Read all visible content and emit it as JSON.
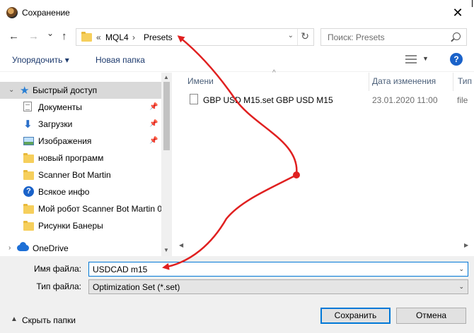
{
  "window": {
    "title": "Сохранение",
    "close": "✕"
  },
  "nav": {
    "back": "←",
    "forward": "→",
    "recent": "⌄",
    "up": "↑",
    "breadcrumb": [
      "«",
      "MQL4",
      "›",
      "Presets"
    ],
    "dropdown": "⌄",
    "refresh": "↻",
    "search_placeholder": "Поиск: Presets"
  },
  "toolbar": {
    "organize": "Упорядочить ▾",
    "new_folder": "Новая папка",
    "help": "?"
  },
  "sidebar": {
    "items": [
      {
        "label": "Быстрый доступ",
        "icon": "star-icon",
        "selected": true
      },
      {
        "label": "Документы",
        "icon": "documents-icon",
        "pinned": true
      },
      {
        "label": "Загрузки",
        "icon": "download-icon",
        "pinned": true
      },
      {
        "label": "Изображения",
        "icon": "pictures-icon",
        "pinned": true
      },
      {
        "label": "новый программ",
        "icon": "folder-icon"
      },
      {
        "label": "Scanner Bot Martin",
        "icon": "folder-icon"
      },
      {
        "label": "Всякое инфо",
        "icon": "question-icon"
      },
      {
        "label": "Мой робот Scanner Bot Martin 0",
        "icon": "folder-icon"
      },
      {
        "label": "Рисунки Банеры",
        "icon": "folder-icon"
      },
      {
        "label": "OneDrive",
        "icon": "cloud-icon"
      }
    ],
    "pin_glyph": "📌"
  },
  "columns": {
    "name": "Имени",
    "date": "Дата изменения",
    "type": "Тип"
  },
  "files": [
    {
      "name": "GBP USD  M15.set  GBP USD  M15",
      "date": "23.01.2020 11:00",
      "type": "file"
    }
  ],
  "form": {
    "filename_label": "Имя файла:",
    "filename_value": "USDCAD m15",
    "filetype_label": "Тип файла:",
    "filetype_value": "Optimization Set (*.set)"
  },
  "footer": {
    "hide_folders": "Скрыть папки",
    "save": "Сохранить",
    "cancel": "Отмена"
  },
  "colors": {
    "accent": "#0078d7",
    "annotation": "#e02020"
  }
}
